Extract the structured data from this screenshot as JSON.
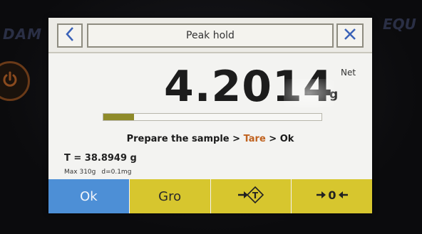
{
  "brand": {
    "left": "DAM",
    "right": "EQU"
  },
  "header": {
    "title": "Peak hold"
  },
  "display": {
    "weight": "4.2014",
    "unit": "g",
    "mode": "Net",
    "progress": 0.14
  },
  "instruction": {
    "part1": "Prepare the sample > ",
    "highlight": "Tare",
    "part2": " > Ok"
  },
  "tare": "T = 38.8949 g",
  "spec": {
    "max": "Max 310g",
    "d": "d=0.1mg"
  },
  "softkeys": {
    "ok": "Ok",
    "gro": "Gro",
    "tare_icon": "tare-arrow-icon",
    "zero_icon": "zero-arrows-icon"
  },
  "colors": {
    "ok_key": "#4d8fd6",
    "softkey": "#d7c62e",
    "progress_fill": "#8f8b2a",
    "highlight": "#c0621f",
    "nav_icon": "#3a62b8"
  }
}
